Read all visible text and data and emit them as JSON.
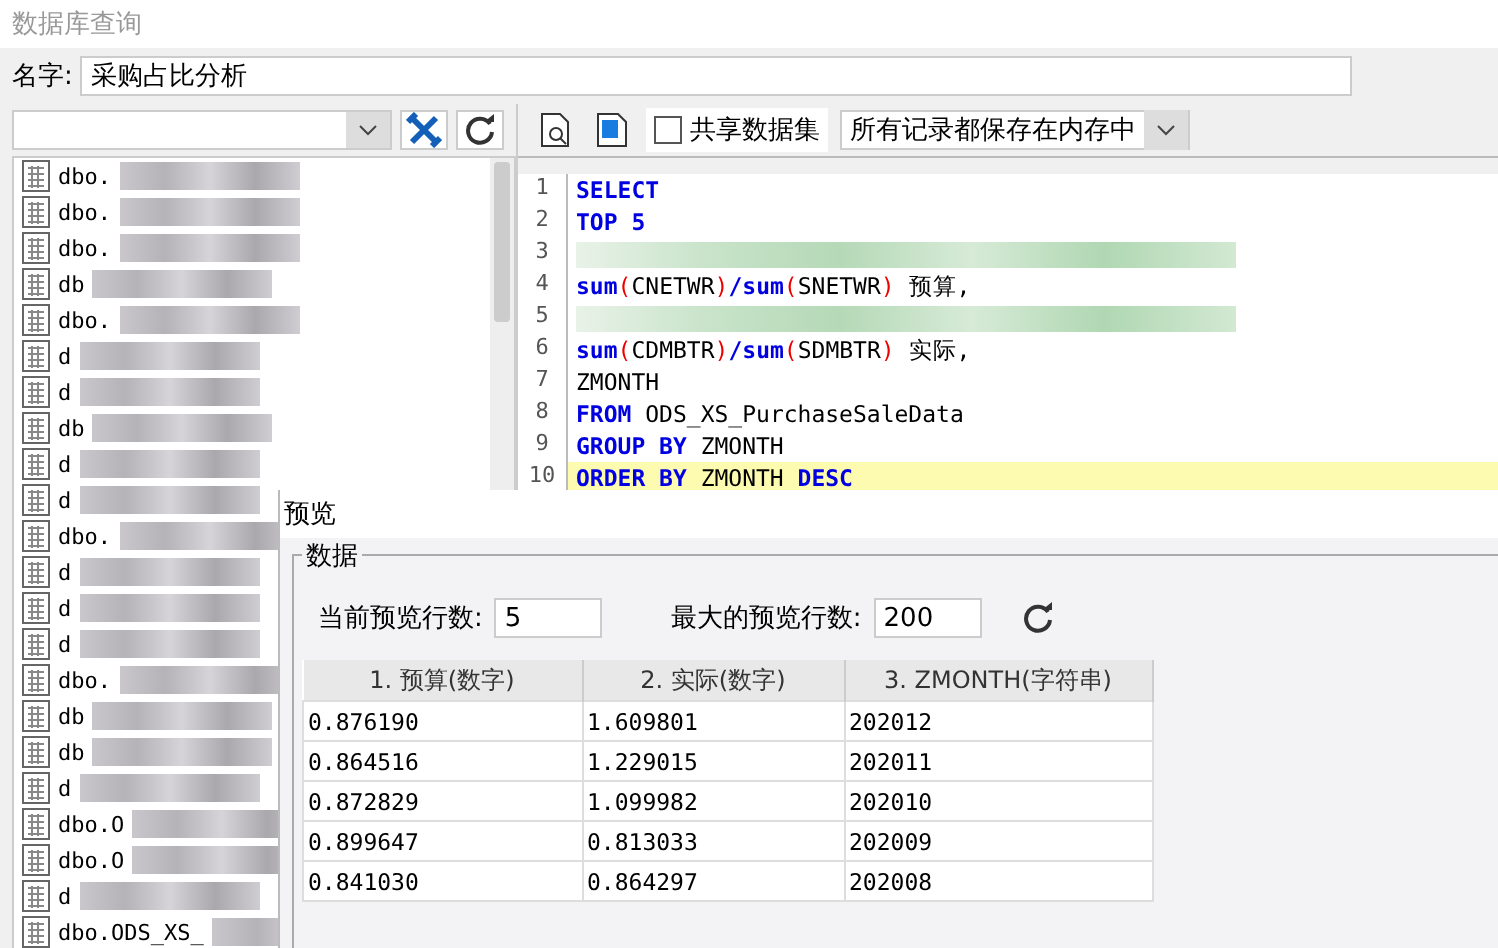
{
  "window": {
    "title": "数据库查询"
  },
  "name_field": {
    "label": "名字:",
    "value": "采购占比分析"
  },
  "tables": [
    {
      "label": "dbo."
    },
    {
      "label": "dbo."
    },
    {
      "label": "dbo."
    },
    {
      "label": "db"
    },
    {
      "label": "dbo."
    },
    {
      "label": "d"
    },
    {
      "label": "d"
    },
    {
      "label": "db"
    },
    {
      "label": "d"
    },
    {
      "label": "d"
    },
    {
      "label": "dbo."
    },
    {
      "label": "d"
    },
    {
      "label": "d"
    },
    {
      "label": "d"
    },
    {
      "label": "dbo."
    },
    {
      "label": "db"
    },
    {
      "label": "db"
    },
    {
      "label": "d"
    },
    {
      "label": "dbo.O"
    },
    {
      "label": "dbo.O"
    },
    {
      "label": "d"
    },
    {
      "label": "dbo.ODS_XS_"
    }
  ],
  "editor_toolbar": {
    "share_checkbox": {
      "label": "共享数据集",
      "checked": false
    },
    "storage_select": {
      "value": "所有记录都保存在内存中"
    }
  },
  "code_lines": [
    {
      "number": "1",
      "current": false,
      "tokens": [
        {
          "text": "SELECT",
          "kind": "keyword"
        }
      ]
    },
    {
      "number": "2",
      "current": false,
      "tokens": [
        {
          "text": "TOP 5",
          "kind": "keyword"
        }
      ]
    },
    {
      "number": "3",
      "current": false,
      "kind": "redacted"
    },
    {
      "number": "4",
      "current": false,
      "tokens": [
        {
          "text": "sum",
          "kind": "keyword"
        },
        {
          "text": "(",
          "kind": "paren"
        },
        {
          "text": "CNETWR",
          "kind": "plain"
        },
        {
          "text": ")",
          "kind": "paren"
        },
        {
          "text": "/",
          "kind": "keyword"
        },
        {
          "text": "sum",
          "kind": "keyword"
        },
        {
          "text": "(",
          "kind": "paren"
        },
        {
          "text": "SNETWR",
          "kind": "plain"
        },
        {
          "text": ")",
          "kind": "paren"
        },
        {
          "text": " 预算,",
          "kind": "plain"
        }
      ]
    },
    {
      "number": "5",
      "current": false,
      "kind": "redacted"
    },
    {
      "number": "6",
      "current": false,
      "tokens": [
        {
          "text": "sum",
          "kind": "keyword"
        },
        {
          "text": "(",
          "kind": "paren"
        },
        {
          "text": "CDMBTR",
          "kind": "plain"
        },
        {
          "text": ")",
          "kind": "paren"
        },
        {
          "text": "/",
          "kind": "keyword"
        },
        {
          "text": "sum",
          "kind": "keyword"
        },
        {
          "text": "(",
          "kind": "paren"
        },
        {
          "text": "SDMBTR",
          "kind": "plain"
        },
        {
          "text": ")",
          "kind": "paren"
        },
        {
          "text": " 实际,",
          "kind": "plain"
        }
      ]
    },
    {
      "number": "7",
      "current": false,
      "tokens": [
        {
          "text": "ZMONTH",
          "kind": "plain"
        }
      ]
    },
    {
      "number": "8",
      "current": false,
      "tokens": [
        {
          "text": "FROM",
          "kind": "keyword"
        },
        {
          "text": " ODS_XS_PurchaseSaleData",
          "kind": "plain"
        }
      ]
    },
    {
      "number": "9",
      "current": false,
      "tokens": [
        {
          "text": "GROUP BY",
          "kind": "keyword"
        },
        {
          "text": " ZMONTH",
          "kind": "plain"
        }
      ]
    },
    {
      "number": "10",
      "current": true,
      "tokens": [
        {
          "text": "ORDER BY",
          "kind": "keyword"
        },
        {
          "text": " ZMONTH ",
          "kind": "plain"
        },
        {
          "text": "DESC",
          "kind": "keyword"
        }
      ]
    }
  ],
  "preview": {
    "title": "预览",
    "group_label": "数据",
    "current_rows": {
      "label": "当前预览行数:",
      "value": "5"
    },
    "max_rows": {
      "label": "最大的预览行数:",
      "value": "200"
    },
    "table": {
      "columns": [
        "1. 预算(数字)",
        "2. 实际(数字)",
        "3. ZMONTH(字符串)"
      ],
      "rows": [
        [
          "0.876190",
          "1.609801",
          "202012"
        ],
        [
          "0.864516",
          "1.229015",
          "202011"
        ],
        [
          "0.872829",
          "1.099982",
          "202010"
        ],
        [
          "0.899647",
          "0.813033",
          "202009"
        ],
        [
          "0.841030",
          "0.864297",
          "202008"
        ]
      ]
    }
  }
}
